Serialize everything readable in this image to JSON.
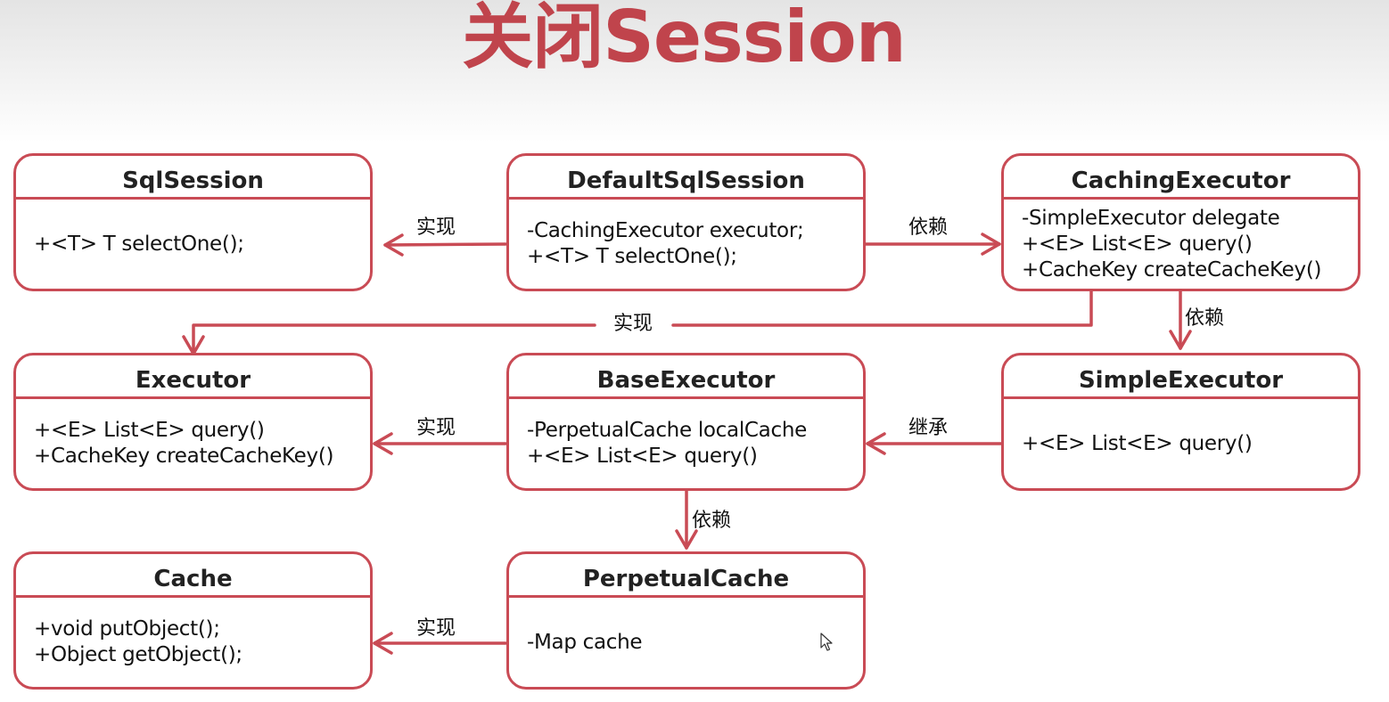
{
  "title": "关闭Session",
  "theme": {
    "accent": "#c94b55",
    "title_color": "#c0444c"
  },
  "classes": {
    "sqlsession": {
      "name": "SqlSession",
      "members": [
        "+<T> T selectOne();"
      ]
    },
    "defaultsqlsession": {
      "name": "DefaultSqlSession",
      "members": [
        "-CachingExecutor executor;",
        "+<T> T selectOne();"
      ]
    },
    "cachingexecutor": {
      "name": "CachingExecutor",
      "members": [
        "-SimpleExecutor delegate",
        "+<E> List<E> query()",
        "+CacheKey createCacheKey()"
      ]
    },
    "executor": {
      "name": "Executor",
      "members": [
        "+<E> List<E> query()",
        "+CacheKey createCacheKey()"
      ]
    },
    "baseexecutor": {
      "name": "BaseExecutor",
      "members": [
        "-PerpetualCache localCache",
        "+<E> List<E> query()"
      ]
    },
    "simpleexecutor": {
      "name": "SimpleExecutor",
      "members": [
        "+<E> List<E> query()"
      ]
    },
    "cache": {
      "name": "Cache",
      "members": [
        "+void putObject();",
        "+Object getObject();"
      ]
    },
    "perpetualcache": {
      "name": "PerpetualCache",
      "members": [
        "-Map cache"
      ]
    }
  },
  "relations": {
    "defaultsqlsession_sqlsession": "实现",
    "defaultsqlsession_cachingexecutor": "依赖",
    "cachingexecutor_executor": "实现",
    "cachingexecutor_simpleexecutor": "依赖",
    "baseexecutor_executor": "实现",
    "simpleexecutor_baseexecutor": "继承",
    "baseexecutor_perpetualcache": "依赖",
    "perpetualcache_cache": "实现"
  }
}
